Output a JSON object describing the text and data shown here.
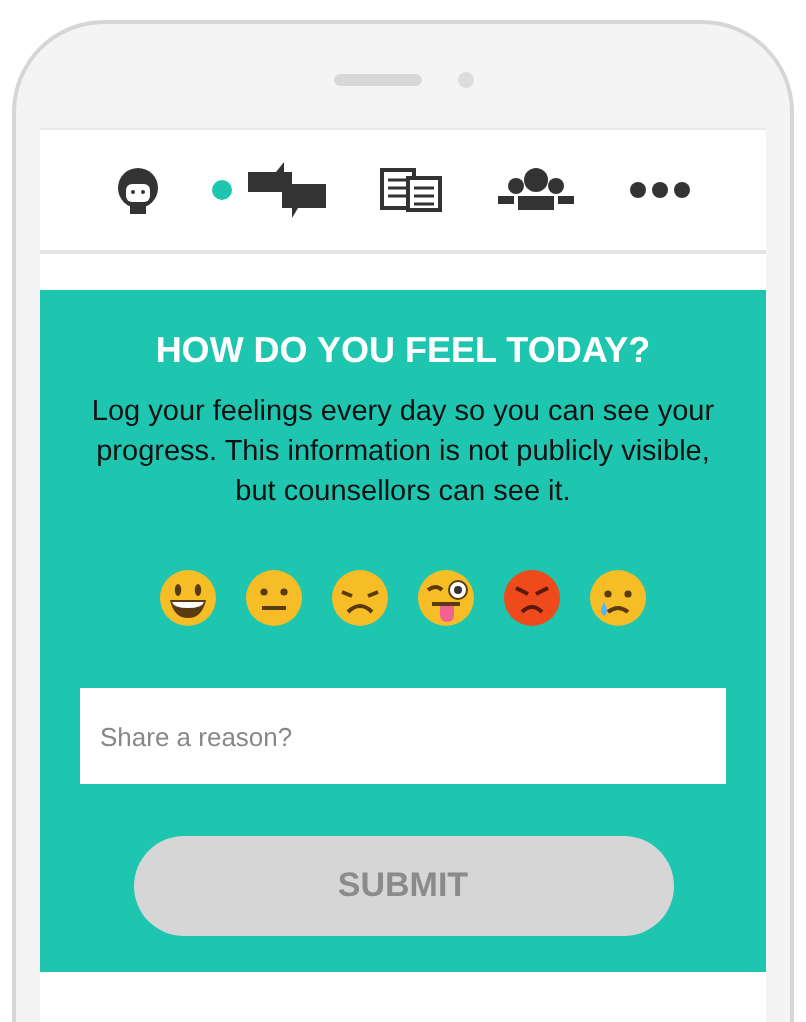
{
  "nav": [
    {
      "kind": "profile",
      "selected": false
    },
    {
      "kind": "chat",
      "selected": true
    },
    {
      "kind": "documents",
      "selected": false
    },
    {
      "kind": "group",
      "selected": false
    },
    {
      "kind": "more",
      "selected": false
    }
  ],
  "mood": {
    "title": "HOW DO YOU FEEL TODAY?",
    "description": "Log your feelings every day so you can see your progress. This information is not publicly visible, but counsellors can see it.",
    "moods": [
      {
        "kind": "grin",
        "selected": false
      },
      {
        "kind": "neutral",
        "selected": false
      },
      {
        "kind": "sad",
        "selected": false
      },
      {
        "kind": "wink",
        "selected": false
      },
      {
        "kind": "angry",
        "selected": false
      },
      {
        "kind": "cry",
        "selected": false
      }
    ],
    "reason": {
      "placeholder": "Share a reason?"
    },
    "submit": "SUBMIT"
  }
}
